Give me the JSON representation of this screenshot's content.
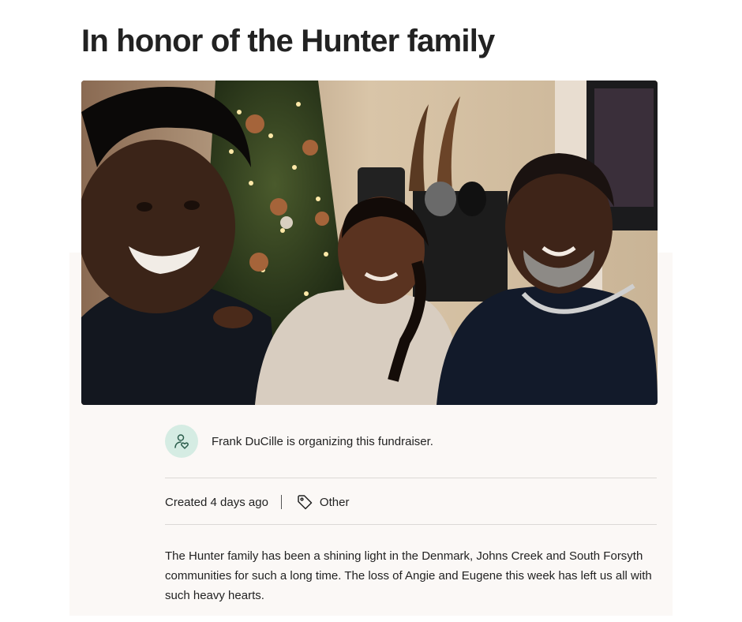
{
  "campaign": {
    "title": "In honor of the Hunter family"
  },
  "hero": {
    "description": "Selfie photo of a young man, a woman and an older man in front of a decorated Christmas tree"
  },
  "organizer": {
    "icon": "person-heart-icon",
    "text": "Frank DuCille is organizing this fundraiser."
  },
  "meta": {
    "created": "Created 4 days ago",
    "category_icon": "tag-icon",
    "category": "Other"
  },
  "story": {
    "text": "The Hunter family has been a shining light in the Denmark, Johns Creek and South Forsyth communities for such a long time.  The loss of Angie and Eugene this week has left us all with such heavy hearts."
  },
  "colors": {
    "avatar_bg": "#d5ece3",
    "avatar_icon": "#2b5d4c",
    "panel_bg": "#fbf8f6",
    "divider": "#dcd9d6"
  }
}
